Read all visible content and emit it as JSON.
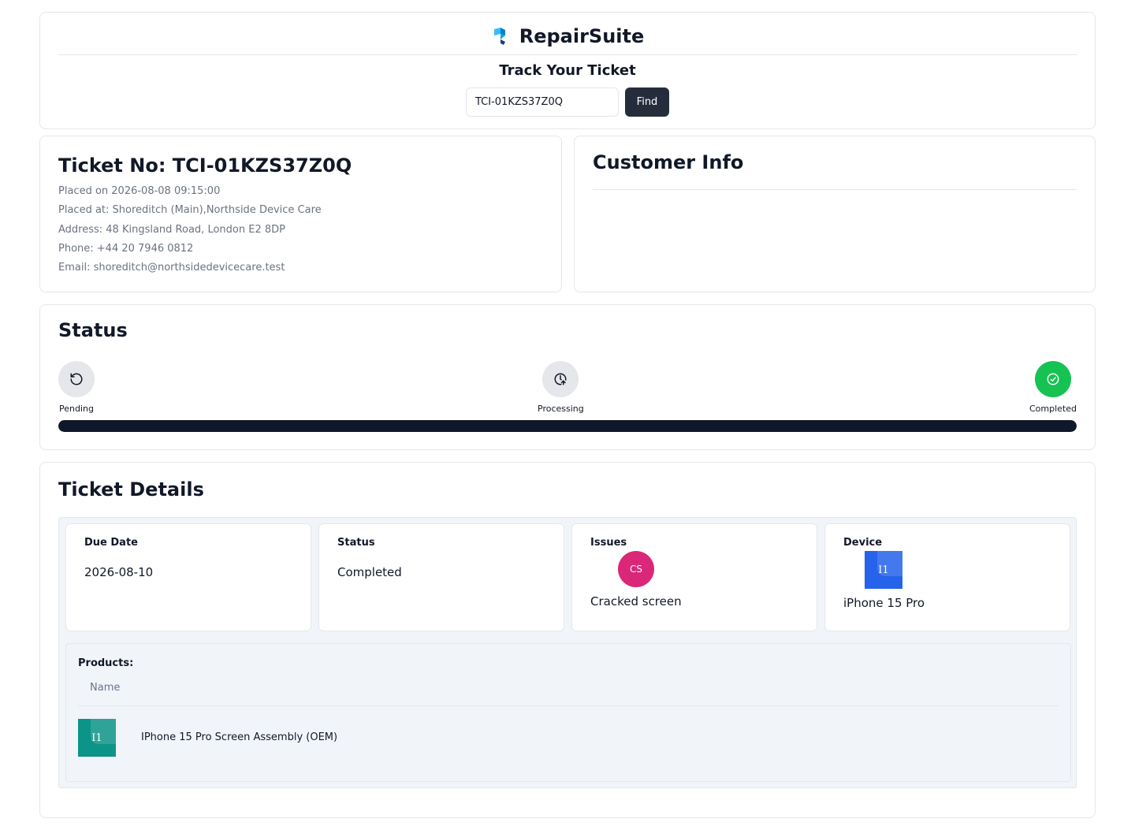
{
  "header": {
    "brand_name": "RepairSuite",
    "track_title": "Track Your Ticket",
    "ticket_input_value": "TCI-01KZS37Z0Q",
    "find_label": "Find"
  },
  "ticket": {
    "title": "Ticket No: TCI-01KZS37Z0Q",
    "placed_on": "Placed on 2026-08-08 09:15:00",
    "placed_at": "Placed at: Shoreditch (Main),Northside Device Care",
    "address": "Address: 48 Kingsland Road, London E2 8DP",
    "phone": "Phone: +44 20 7946 0812",
    "email": "Email: shoreditch@northsidedevicecare.test"
  },
  "customer": {
    "title": "Customer Info"
  },
  "status": {
    "title": "Status",
    "steps": [
      {
        "label": "Pending",
        "icon": "history-icon",
        "completed": false
      },
      {
        "label": "Processing",
        "icon": "clock-arrow-icon",
        "completed": false
      },
      {
        "label": "Completed",
        "icon": "check-circle-icon",
        "completed": true
      }
    ],
    "progress_percent": 100,
    "colors": {
      "completed": "#16c252",
      "progress": "#0f172a"
    }
  },
  "details": {
    "title": "Ticket Details",
    "due_date_label": "Due Date",
    "due_date_value": "2026-08-10",
    "status_label": "Status",
    "status_value": "Completed",
    "issues_label": "Issues",
    "issue_initials": "CS",
    "issue_name": "Cracked screen",
    "device_label": "Device",
    "device_initials": "I1",
    "device_name": "iPhone 15 Pro",
    "products_title": "Products:",
    "products_name_header": "Name",
    "products": [
      {
        "initials": "I1",
        "name": "IPhone 15 Pro Screen Assembly (OEM)"
      }
    ]
  }
}
